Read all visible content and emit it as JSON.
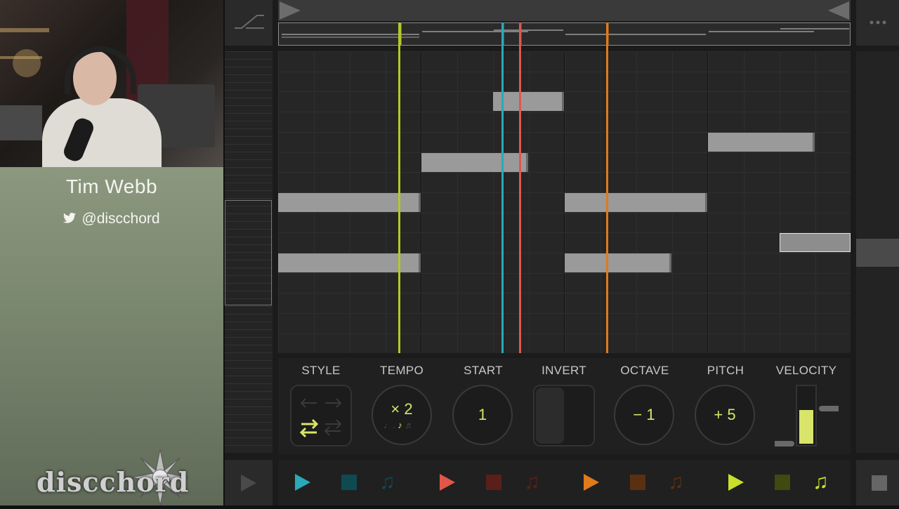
{
  "presenter": {
    "name": "Tim Webb",
    "twitter": "@discchord",
    "logo_text": "discchord"
  },
  "controls": {
    "style_label": "STYLE",
    "tempo_label": "TEMPO",
    "tempo_value": "× 2",
    "start_label": "START",
    "start_value": "1",
    "invert_label": "INVERT",
    "octave_label": "OCTAVE",
    "octave_value": "− 1",
    "pitch_label": "PITCH",
    "pitch_value": "+ 5",
    "velocity_label": "VELOCITY"
  },
  "colors": {
    "yellow": "#b5c72a",
    "cyan": "#2aa9b8",
    "red": "#e0574a",
    "orange": "#e07a1a",
    "accent_text": "#d8e46a"
  },
  "transport": [
    {
      "color": "#2aa9b8",
      "dim": "#0f4a52"
    },
    {
      "color": "#e0574a",
      "dim": "#5a1f1a"
    },
    {
      "color": "#e07a1a",
      "dim": "#5a3010"
    },
    {
      "color": "#c8e02a",
      "dim": "#3e4a10"
    }
  ],
  "icons": {
    "twitter": "bird-icon",
    "more": "ellipsis-icon",
    "curve": "ramp-icon",
    "play": "play-icon",
    "stop": "stop-icon",
    "note": "music-note-icon",
    "style": "swap-arrows-icon"
  }
}
